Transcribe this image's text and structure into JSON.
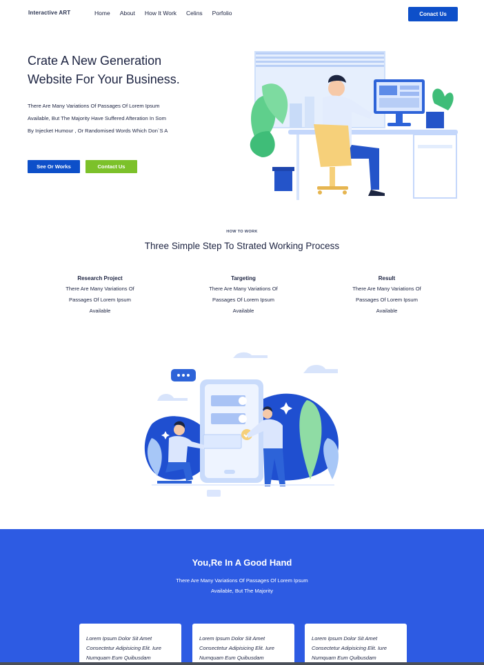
{
  "nav": {
    "brand": "Interactive ART",
    "items": [
      "Home",
      "About",
      "How It Work",
      "Celins",
      "Porfolio"
    ],
    "cta": "Conact Us"
  },
  "hero": {
    "title_line1": "Crate A New Generation",
    "title_line2": "Website For Your Business.",
    "text_lines": [
      "There Are Many Variations Of Passages Of Lorem Ipsum",
      "Available, But The Majority Have Suffered Afteration In Som",
      "By Injecket Humour , Or Randomised Words Which Don`S A"
    ],
    "button_primary": "See Or Works",
    "button_secondary": "Contact Us"
  },
  "how": {
    "eyebrow": "HOW TO WORK",
    "title": "Three Simple Step To Strated Working Process",
    "steps": [
      {
        "title": "Research Project",
        "lines": [
          "There Are Many Variations Of",
          "Passages Of Lorem Ipsum",
          "Available"
        ]
      },
      {
        "title": "Targeting",
        "lines": [
          "There Are Many Variations Of",
          "Passages Of Lorem Ipsum",
          "Available"
        ]
      },
      {
        "title": "Result",
        "lines": [
          "There Are Many Variations Of",
          "Passages Of Lorem Ipsum",
          "Available"
        ]
      }
    ]
  },
  "good_hand": {
    "title": "You,Re In A Good Hand",
    "text_line1": "There Are Many Variations Of Passages Of Lorem Ipsum",
    "text_line2": "Available, But The Majority",
    "cards": [
      {
        "lines": [
          "Lorem Ipsum Dolor Sit Amet",
          "Consectetur Adipisicing Elit. Iure",
          "Numquam Eum Quibusdam"
        ]
      },
      {
        "lines": [
          "Lorem Ipsum Dolor Sit Amet",
          "Consectetur Adipisicing Elit. Iure",
          "Numquam Eum Quibusdam"
        ]
      },
      {
        "lines": [
          "Lorem Ipsum Dolor Sit Amet",
          "Consectetur Adipisicing Elit. Iure",
          "Numquam Eum Quibusdam"
        ]
      }
    ]
  },
  "colors": {
    "primary": "#0d4fc9",
    "accent_green": "#7cc12a",
    "section_blue": "#2d5be3",
    "text_dark": "#1b2240"
  },
  "icons": {
    "hero_illustration": "person-at-desk-illustration",
    "middle_illustration": "phone-collaboration-illustration"
  }
}
